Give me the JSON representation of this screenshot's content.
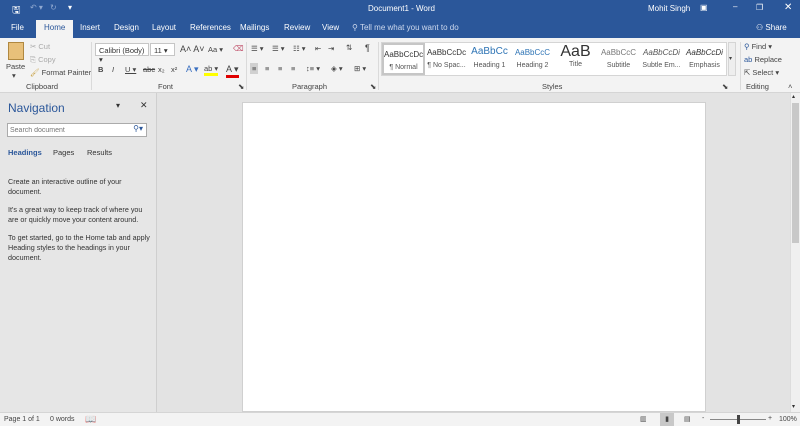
{
  "title_bar": {
    "title": "Document1  -  Word",
    "user": "Mohit Singh"
  },
  "tabs": [
    "File",
    "Home",
    "Insert",
    "Design",
    "Layout",
    "References",
    "Mailings",
    "Review",
    "View"
  ],
  "tell_me": "Tell me what you want to do",
  "share": "Share",
  "clipboard": {
    "paste": "Paste",
    "cut": "Cut",
    "copy": "Copy",
    "format_painter": "Format Painter",
    "label": "Clipboard"
  },
  "font": {
    "name": "Calibri (Body)",
    "size": "11",
    "label": "Font",
    "aa": "Aa"
  },
  "paragraph": {
    "label": "Paragraph"
  },
  "styles": {
    "label": "Styles",
    "items": [
      {
        "preview": "AaBbCcDc",
        "name": "¶ Normal"
      },
      {
        "preview": "AaBbCcDc",
        "name": "¶ No Spac..."
      },
      {
        "preview": "AaBbCc",
        "name": "Heading 1"
      },
      {
        "preview": "AaBbCcC",
        "name": "Heading 2"
      },
      {
        "preview": "AaB",
        "name": "Title"
      },
      {
        "preview": "AaBbCcC",
        "name": "Subtitle"
      },
      {
        "preview": "AaBbCcDi",
        "name": "Subtle Em..."
      },
      {
        "preview": "AaBbCcDi",
        "name": "Emphasis"
      }
    ]
  },
  "editing": {
    "find": "Find",
    "replace": "Replace",
    "select": "Select",
    "label": "Editing"
  },
  "navigation": {
    "title": "Navigation",
    "search_placeholder": "Search document",
    "tabs": [
      "Headings",
      "Pages",
      "Results"
    ],
    "text1": "Create an interactive outline of your document.",
    "text2": "It's a great way to keep track of where you are or quickly move your content around.",
    "text3": "To get started, go to the Home tab and apply Heading styles to the headings in your document."
  },
  "status": {
    "page": "Page 1 of 1",
    "words": "0 words",
    "zoom": "100%",
    "zoom_percent": 100
  }
}
